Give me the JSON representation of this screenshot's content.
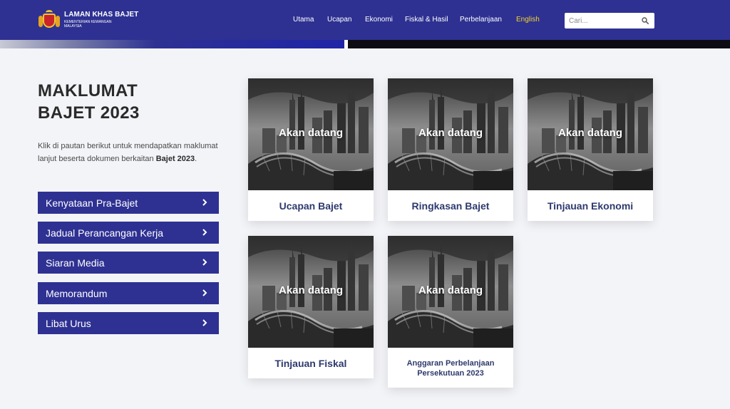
{
  "header": {
    "logo_title": "LAMAN KHAS BAJET",
    "logo_sub_1": "KEMENTERIAN KEWANGAN",
    "logo_sub_2": "MALAYSIA",
    "nav": [
      "Utama",
      "Ucapan",
      "Ekonomi",
      "Fiskal & Hasil",
      "Perbelanjaan",
      "English"
    ],
    "search_placeholder": "Cari...",
    "colors": {
      "primary": "#2e3192",
      "language_highlight": "#f2d32a"
    }
  },
  "sidebar": {
    "title_line_1": "MAKLUMAT",
    "title_line_2": "BAJET 2023",
    "intro_text": "Klik di pautan berikut untuk mendapatkan maklumat lanjut beserta dokumen berkaitan ",
    "intro_bold": "Bajet 2023",
    "intro_end": ".",
    "buttons": [
      "Kenyataan Pra-Bajet",
      "Jadual Perancangan Kerja",
      "Siaran Media",
      "Memorandum",
      "Libat Urus"
    ]
  },
  "cards": [
    {
      "overlay": "Akan datang",
      "label": "Ucapan Bajet"
    },
    {
      "overlay": "Akan datang",
      "label": "Ringkasan Bajet"
    },
    {
      "overlay": "Akan datang",
      "label": "Tinjauan Ekonomi"
    },
    {
      "overlay": "Akan datang",
      "label": "Tinjauan Fiskal"
    },
    {
      "overlay": "Akan datang",
      "label_line_1": "Anggaran Perbelanjaan",
      "label_line_2": "Persekutuan 2023"
    }
  ]
}
